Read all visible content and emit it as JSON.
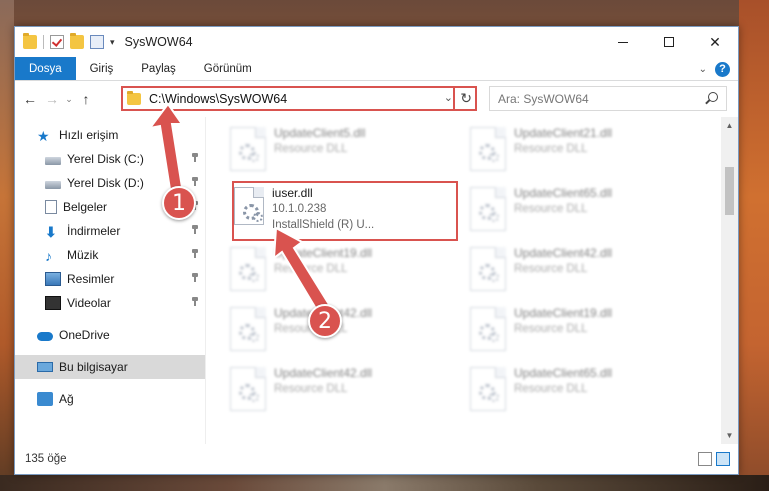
{
  "window": {
    "title": "SysWOW64"
  },
  "ribbon": {
    "tabs": [
      "Dosya",
      "Giriş",
      "Paylaş",
      "Görünüm"
    ],
    "active_tab": "Dosya"
  },
  "navigation": {
    "address": "C:\\Windows\\SysWOW64",
    "search_placeholder": "Ara: SysWOW64"
  },
  "sidebar": {
    "items": [
      {
        "label": "Hızlı erişim",
        "icon": "star-icon",
        "pinned": false
      },
      {
        "label": "Yerel Disk (C:)",
        "icon": "disk-icon",
        "pinned": true
      },
      {
        "label": "Yerel Disk (D:)",
        "icon": "disk-icon",
        "pinned": true
      },
      {
        "label": "Belgeler",
        "icon": "documents-icon",
        "pinned": true
      },
      {
        "label": "İndirmeler",
        "icon": "download-icon",
        "pinned": true
      },
      {
        "label": "Müzik",
        "icon": "music-icon",
        "pinned": true
      },
      {
        "label": "Resimler",
        "icon": "pictures-icon",
        "pinned": true
      },
      {
        "label": "Videolar",
        "icon": "videos-icon",
        "pinned": true
      },
      {
        "label": "OneDrive",
        "icon": "onedrive-icon",
        "pinned": false
      },
      {
        "label": "Bu bilgisayar",
        "icon": "computer-icon",
        "pinned": false,
        "selected": true
      },
      {
        "label": "Ağ",
        "icon": "network-icon",
        "pinned": false
      }
    ]
  },
  "files": [
    {
      "name": "UpdateClient5.dll",
      "sub1": "Resource DLL",
      "sub2": "",
      "blurred": true
    },
    {
      "name": "UpdateClient21.dll",
      "sub1": "Resource DLL",
      "sub2": "",
      "blurred": true
    },
    {
      "name": "iuser.dll",
      "sub1": "10.1.0.238",
      "sub2": "InstallShield (R) U...",
      "blurred": false
    },
    {
      "name": "UpdateClient65.dll",
      "sub1": "Resource DLL",
      "sub2": "",
      "blurred": true
    },
    {
      "name": "UpdateClient19.dll",
      "sub1": "Resource DLL",
      "sub2": "",
      "blurred": true
    },
    {
      "name": "UpdateClient42.dll",
      "sub1": "Resource DLL",
      "sub2": "",
      "blurred": true
    },
    {
      "name": "UpdateClient42.dll",
      "sub1": "Resource DLL",
      "sub2": "",
      "blurred": true
    },
    {
      "name": "UpdateClient19.dll",
      "sub1": "Resource DLL",
      "sub2": "",
      "blurred": true
    },
    {
      "name": "UpdateClient42.dll",
      "sub1": "Resource DLL",
      "sub2": "",
      "blurred": true
    },
    {
      "name": "UpdateClient65.dll",
      "sub1": "Resource DLL",
      "sub2": "",
      "blurred": true
    }
  ],
  "status": {
    "item_count": "135 öğe"
  },
  "callouts": [
    "1",
    "2"
  ],
  "colors": {
    "accent": "#1979ca",
    "highlight": "#d9534f"
  }
}
